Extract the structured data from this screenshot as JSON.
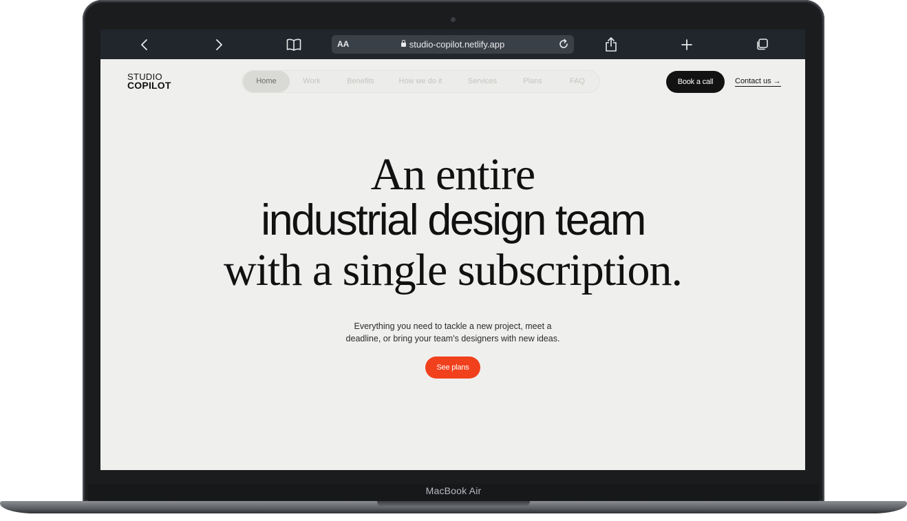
{
  "device": {
    "label": "MacBook Air"
  },
  "browser": {
    "text_size_label": "AA",
    "url": "studio-copilot.netlify.app"
  },
  "site": {
    "logo": {
      "line1": "STUDIO",
      "line2": "COPILOT"
    },
    "nav": {
      "items": [
        {
          "label": "Home",
          "active": true
        },
        {
          "label": "Work"
        },
        {
          "label": "Benefits"
        },
        {
          "label": "How we do it"
        },
        {
          "label": "Services"
        },
        {
          "label": "Plans"
        },
        {
          "label": "FAQ"
        }
      ]
    },
    "book_call_label": "Book a call",
    "contact_label": "Contact us →"
  },
  "hero": {
    "line1": "An entire",
    "line2": "industrial design team",
    "line3": "with a single subscription.",
    "subtitle_line1": "Everything you need to tackle a new project, meet a",
    "subtitle_line2": "deadline, or bring your team's designers with new ideas.",
    "cta_label": "See plans"
  },
  "colors": {
    "accent": "#f1401c",
    "page_bg": "#efefee",
    "toolbar_bg": "#20262c"
  }
}
